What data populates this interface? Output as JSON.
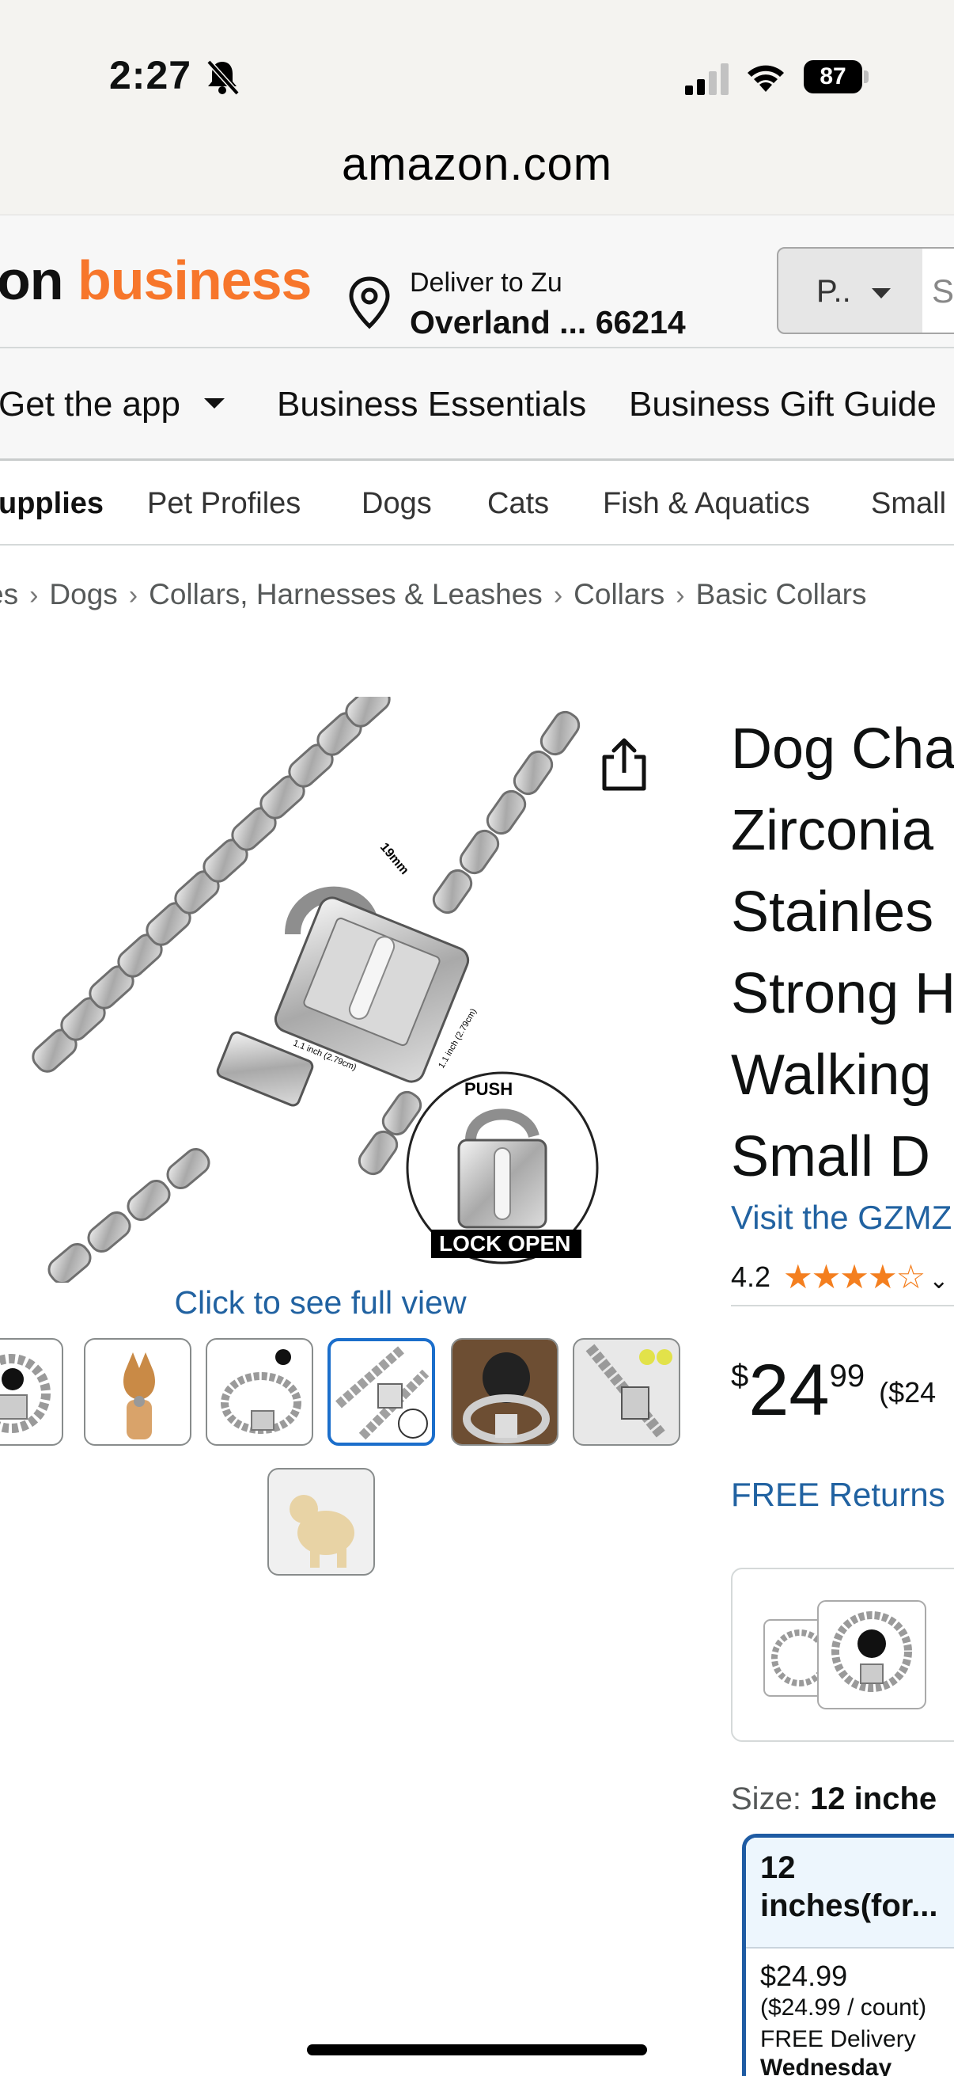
{
  "status_bar": {
    "time": "2:27",
    "battery": "87"
  },
  "browser": {
    "url": "amazon.com"
  },
  "header": {
    "logo_part1": "on",
    "logo_part2": " business",
    "deliver_line1": "Deliver to Zu",
    "deliver_line2": "Overland ... 66214",
    "search_category": "P..",
    "search_placeholder": "S"
  },
  "nav_primary": [
    {
      "label": "Get the app"
    },
    {
      "label": "Business Essentials"
    },
    {
      "label": "Business Gift Guide"
    }
  ],
  "nav_secondary": [
    {
      "label": "upplies"
    },
    {
      "label": "Pet Profiles"
    },
    {
      "label": "Dogs"
    },
    {
      "label": "Cats"
    },
    {
      "label": "Fish & Aquatics"
    },
    {
      "label": "Small"
    }
  ],
  "breadcrumb": [
    "es",
    "Dogs",
    "Collars, Harnesses & Leashes",
    "Collars",
    "Basic Collars"
  ],
  "gallery": {
    "full_view_label": "Click to see full view",
    "image_labels": {
      "dim1": "19mm",
      "dim2": "1.1 inch (2.79cm)",
      "dim3": "1.1 inch (2.79cm)",
      "push": "PUSH",
      "lock_open": "LOCK OPEN"
    },
    "selected_index": 3
  },
  "product": {
    "title_lines": [
      "Dog Cha",
      "Zirconia",
      "Stainles",
      "Strong H",
      "Walking",
      "Small D"
    ],
    "store_link": "Visit the GZMZ",
    "rating": "4.2",
    "rating_value": 4.2,
    "price_symbol": "$",
    "price_whole": "24",
    "price_fraction": "99",
    "price_unit": "($24",
    "returns": "FREE Returns"
  },
  "size": {
    "label": "Size:",
    "selected": "12 inche",
    "option_name": "12 inches(for...",
    "option_price": "$24.99",
    "option_unit": "($24.99 / count)",
    "option_delivery": "FREE Delivery",
    "option_day": "Wednesday"
  },
  "colors": {
    "accent_orange": "#f7762b",
    "link_blue": "#2162a1",
    "star_orange": "#f47f1f",
    "selected_border": "#1e5ba3"
  }
}
